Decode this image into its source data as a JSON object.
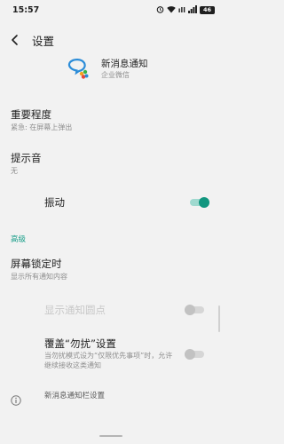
{
  "status_bar": {
    "time": "15:57",
    "signal_text": "ıll",
    "battery": "46"
  },
  "appbar": {
    "title": "设置"
  },
  "app": {
    "name": "新消息通知",
    "subtitle": "企业微信"
  },
  "importance": {
    "title": "重要程度",
    "subtitle": "紧急: 在屏幕上弹出"
  },
  "sound": {
    "title": "提示音",
    "subtitle": "无"
  },
  "vibration": {
    "title": "振动",
    "enabled": true
  },
  "section_advanced": "高级",
  "lockscreen": {
    "title": "屏幕锁定时",
    "subtitle": "显示所有通知内容"
  },
  "badge": {
    "title": "显示通知圆点",
    "enabled": false,
    "disabled": true
  },
  "dnd": {
    "title": "覆盖“勿扰”设置",
    "subtitle": "当勿扰模式设为“仅限优先事项”时，允许继续接收这类通知",
    "enabled": false
  },
  "footer": {
    "label": "新消息通知栏设置"
  },
  "colors": {
    "accent": "#12967f",
    "background": "#f2f2f2"
  },
  "icons": {
    "back": "back-arrow-icon",
    "app": "wecom-app-icon",
    "info": "info-icon"
  }
}
